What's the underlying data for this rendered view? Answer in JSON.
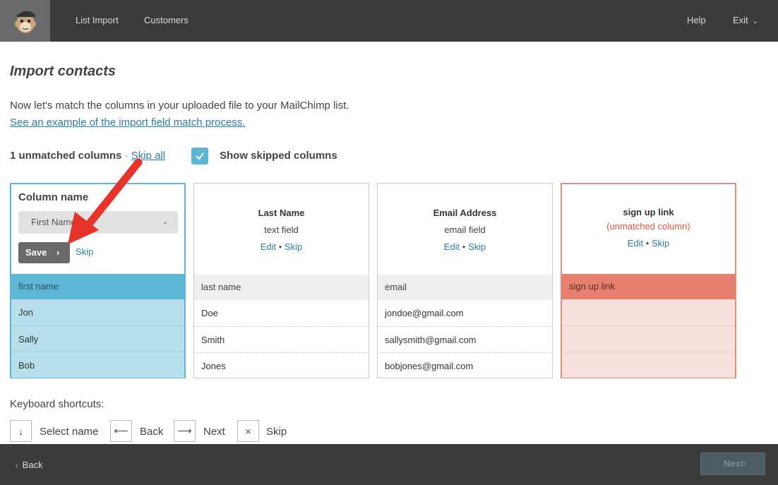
{
  "topbar": {
    "nav": [
      "List Import",
      "Customers"
    ],
    "help_label": "Help",
    "exit_label": "Exit"
  },
  "page": {
    "title": "Import contacts",
    "intro": "Now let's match the columns in your uploaded file to your MailChimp list.",
    "example_link": "See an example of the import field match process.",
    "unmatched_count_label": "1 unmatched columns",
    "separator": "·",
    "skip_all_label": "Skip all",
    "show_skipped_label": "Show skipped columns",
    "show_skipped_checked": true
  },
  "columns": [
    {
      "state": "editing",
      "column_name_label": "Column name",
      "selected_field": "First Name",
      "save_label": "Save",
      "skip_label": "Skip",
      "header": "first name",
      "rows": [
        "Jon",
        "Sally",
        "Bob"
      ]
    },
    {
      "state": "matched",
      "field_name": "Last Name",
      "field_type": "text field",
      "edit_label": "Edit",
      "dot": "•",
      "skip_label": "Skip",
      "header": "last name",
      "rows": [
        "Doe",
        "Smith",
        "Jones"
      ]
    },
    {
      "state": "matched",
      "field_name": "Email Address",
      "field_type": "email field",
      "edit_label": "Edit",
      "dot": "•",
      "skip_label": "Skip",
      "header": "email",
      "rows": [
        "jondoe@gmail.com",
        "sallysmith@gmail.com",
        "bobjones@gmail.com"
      ]
    },
    {
      "state": "unmatched",
      "field_name": "sign up link",
      "unmatched_note": "(unmatched column)",
      "edit_label": "Edit",
      "dot": "•",
      "skip_label": "Skip",
      "header": "sign up link",
      "rows": [
        "",
        "",
        ""
      ]
    }
  ],
  "shortcuts": {
    "title": "Keyboard shortcuts:",
    "items": [
      {
        "key": "↓",
        "label": "Select name"
      },
      {
        "key": "⟵",
        "label": "Back"
      },
      {
        "key": "⟶",
        "label": "Next"
      },
      {
        "key": "×",
        "label": "Skip"
      }
    ]
  },
  "footer": {
    "back_label": "Back",
    "next_label": "Next",
    "next_enabled": false
  },
  "colors": {
    "accent": "#5eb6d5",
    "link": "#2c7ea3",
    "unmatched": "#e8806f",
    "topbar": "#3b3b3b"
  }
}
